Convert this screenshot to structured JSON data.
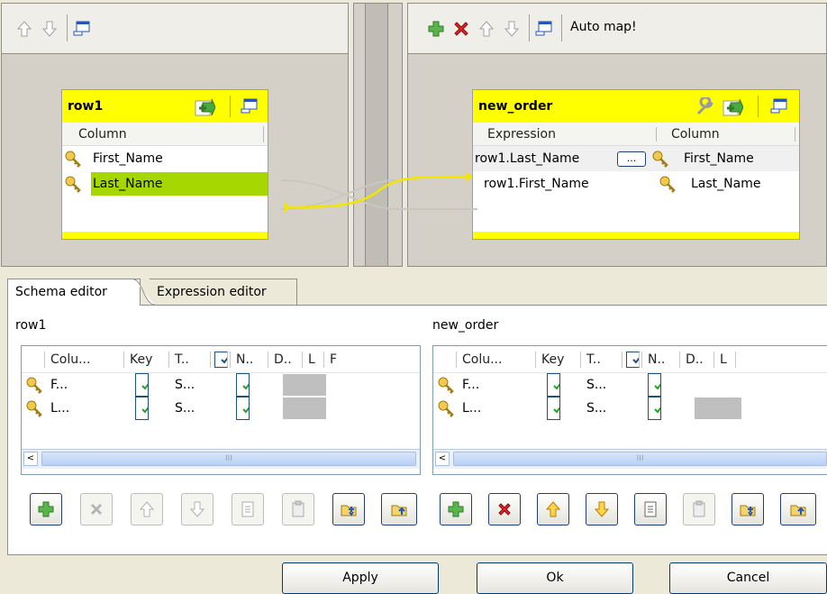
{
  "left_map": {
    "table_title": "row1",
    "column_header": "Column",
    "rows": [
      "First_Name",
      "Last_Name"
    ]
  },
  "right_map": {
    "auto_map_label": "Auto map!",
    "table_title": "new_order",
    "expression_header": "Expression",
    "column_header": "Column",
    "rows": [
      {
        "expression": "row1.Last_Name",
        "column": "First_Name",
        "button": "..."
      },
      {
        "expression": "row1.First_Name",
        "column": "Last_Name"
      }
    ]
  },
  "tabs": [
    "Schema editor",
    "Expression editor"
  ],
  "schema_left": {
    "title": "row1",
    "headers": [
      "Colu...",
      "Key",
      "T..",
      "N..",
      "D..",
      "L",
      "F"
    ],
    "rows": [
      {
        "column": "F...",
        "type": "S..."
      },
      {
        "column": "L...",
        "type": "S..."
      }
    ],
    "scroll_grip": "III"
  },
  "schema_right": {
    "title": "new_order",
    "headers": [
      "Colu...",
      "Key",
      "T..",
      "N..",
      "D..",
      "L"
    ],
    "rows": [
      {
        "column": "F...",
        "type": "S..."
      },
      {
        "column": "L...",
        "type": "S..."
      }
    ],
    "scroll_grip": "III"
  },
  "dialog_buttons": {
    "apply": "Apply",
    "ok": "Ok",
    "cancel": "Cancel"
  },
  "colors": {
    "yellow": "#ffff00",
    "selection_green": "#a6d700",
    "link": "#e6d800"
  }
}
